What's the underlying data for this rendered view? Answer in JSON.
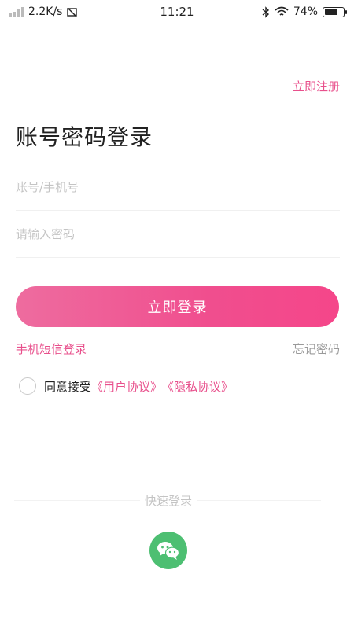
{
  "status_bar": {
    "network_speed": "2.2K/s",
    "time": "11:21",
    "battery_percent": "74%",
    "battery_level": 0.74
  },
  "header": {
    "register_label": "立即注册"
  },
  "login_form": {
    "title": "账号密码登录",
    "account_placeholder": "账号/手机号",
    "password_placeholder": "请输入密码",
    "submit_label": "立即登录",
    "sms_login_label": "手机短信登录",
    "forgot_password_label": "忘记密码"
  },
  "agreement": {
    "prefix": "同意接受",
    "user_agreement": "《用户协议》",
    "privacy_policy": "《隐私协议》",
    "checked": false
  },
  "quick_login": {
    "label": "快速登录",
    "options": [
      {
        "icon": "wechat-icon",
        "color": "#4dbf72"
      }
    ]
  },
  "colors": {
    "accent": "#e8508c",
    "button_gradient_start": "#ee6c9f",
    "button_gradient_end": "#f5468a",
    "wechat_green": "#4dbf72"
  }
}
